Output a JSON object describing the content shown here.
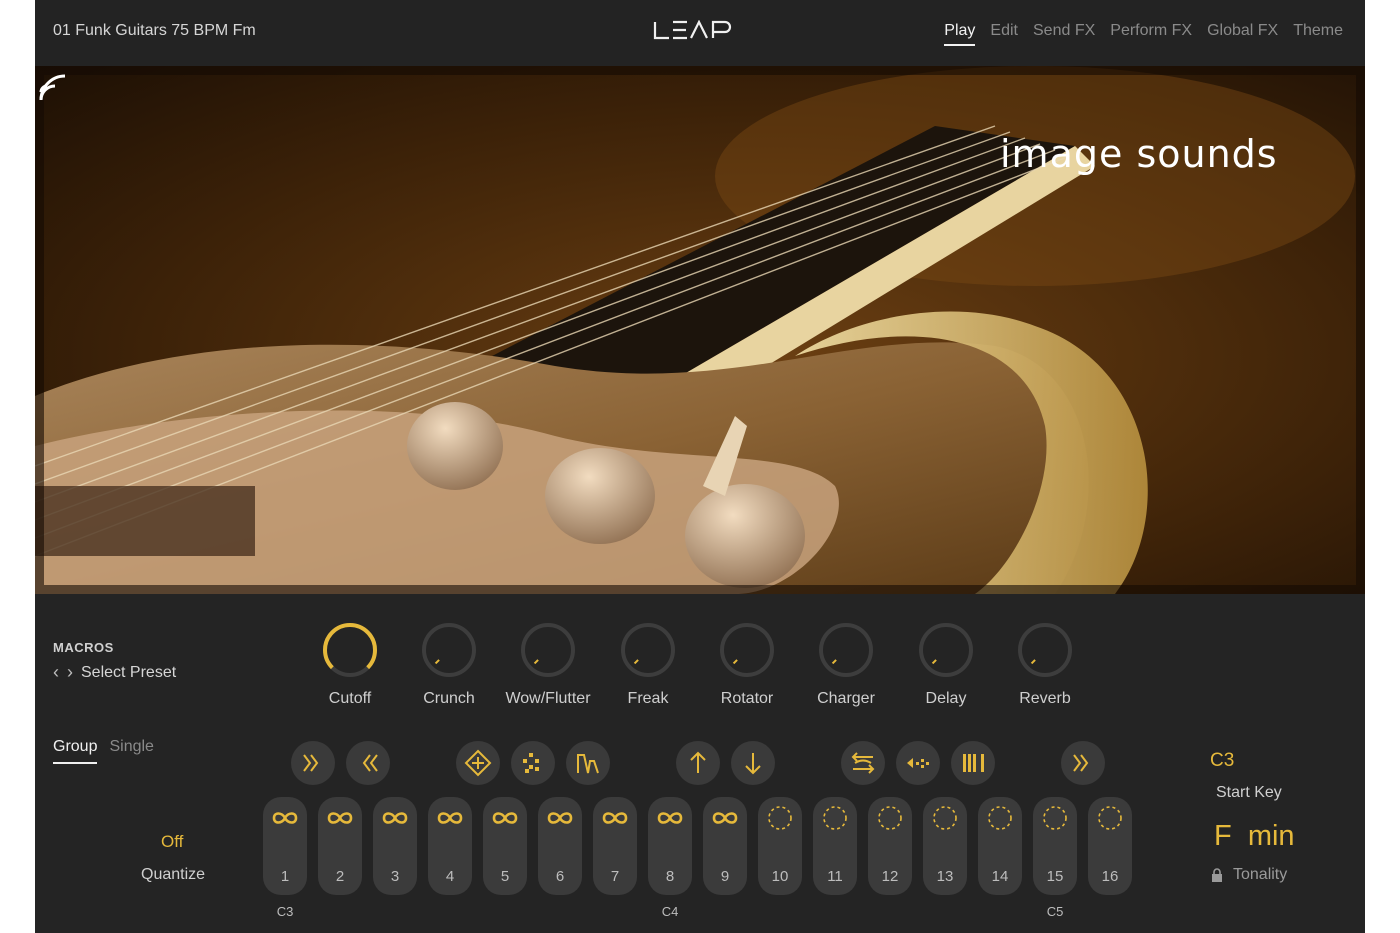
{
  "header": {
    "preset_name": "01 Funk Guitars 75 BPM Fm",
    "logo": "LEAP",
    "tabs": [
      {
        "label": "Play",
        "active": true
      },
      {
        "label": "Edit",
        "active": false
      },
      {
        "label": "Send FX",
        "active": false
      },
      {
        "label": "Perform FX",
        "active": false
      },
      {
        "label": "Global FX",
        "active": false
      },
      {
        "label": "Theme",
        "active": false
      }
    ]
  },
  "hero": {
    "brand": "image sounds"
  },
  "macros": {
    "title": "MACROS",
    "preset_label": "Select Preset",
    "knobs": [
      {
        "label": "Cutoff",
        "level": 1.0
      },
      {
        "label": "Crunch",
        "level": 0.0
      },
      {
        "label": "Wow/Flutter",
        "level": 0.0
      },
      {
        "label": "Freak",
        "level": 0.0
      },
      {
        "label": "Rotator",
        "level": 0.0
      },
      {
        "label": "Charger",
        "level": 0.0
      },
      {
        "label": "Delay",
        "level": 0.0
      },
      {
        "label": "Reverb",
        "level": 0.0
      }
    ]
  },
  "mode": {
    "group": "Group",
    "single": "Single"
  },
  "actions": [
    {
      "icon": "fast-forward-icon"
    },
    {
      "icon": "rewind-icon"
    },
    {
      "icon": "shuffle-diamond-icon"
    },
    {
      "icon": "random-diamond-icon"
    },
    {
      "icon": "envelope-shape-icon"
    },
    {
      "icon": "arrow-up-icon"
    },
    {
      "icon": "arrow-down-icon"
    },
    {
      "icon": "swap-icon"
    },
    {
      "icon": "reverse-icon"
    },
    {
      "icon": "bars-icon"
    },
    {
      "icon": "fast-forward-icon"
    }
  ],
  "pads": [
    {
      "num": "1",
      "state": "loop"
    },
    {
      "num": "2",
      "state": "loop"
    },
    {
      "num": "3",
      "state": "loop"
    },
    {
      "num": "4",
      "state": "loop"
    },
    {
      "num": "5",
      "state": "loop"
    },
    {
      "num": "6",
      "state": "loop"
    },
    {
      "num": "7",
      "state": "loop"
    },
    {
      "num": "8",
      "state": "loop"
    },
    {
      "num": "9",
      "state": "loop"
    },
    {
      "num": "10",
      "state": "oneshot"
    },
    {
      "num": "11",
      "state": "oneshot"
    },
    {
      "num": "12",
      "state": "oneshot"
    },
    {
      "num": "13",
      "state": "oneshot"
    },
    {
      "num": "14",
      "state": "oneshot"
    },
    {
      "num": "15",
      "state": "oneshot"
    },
    {
      "num": "16",
      "state": "oneshot"
    }
  ],
  "octaves": [
    "C3",
    "C4",
    "C5"
  ],
  "quantize": {
    "value": "Off",
    "label": "Quantize"
  },
  "start_key": {
    "value": "C3",
    "label": "Start Key"
  },
  "tonality": {
    "value": "F  min",
    "label": "Tonality"
  },
  "colors": {
    "accent": "#e6b93b",
    "background": "#242424",
    "pad": "#3b3b3b"
  }
}
